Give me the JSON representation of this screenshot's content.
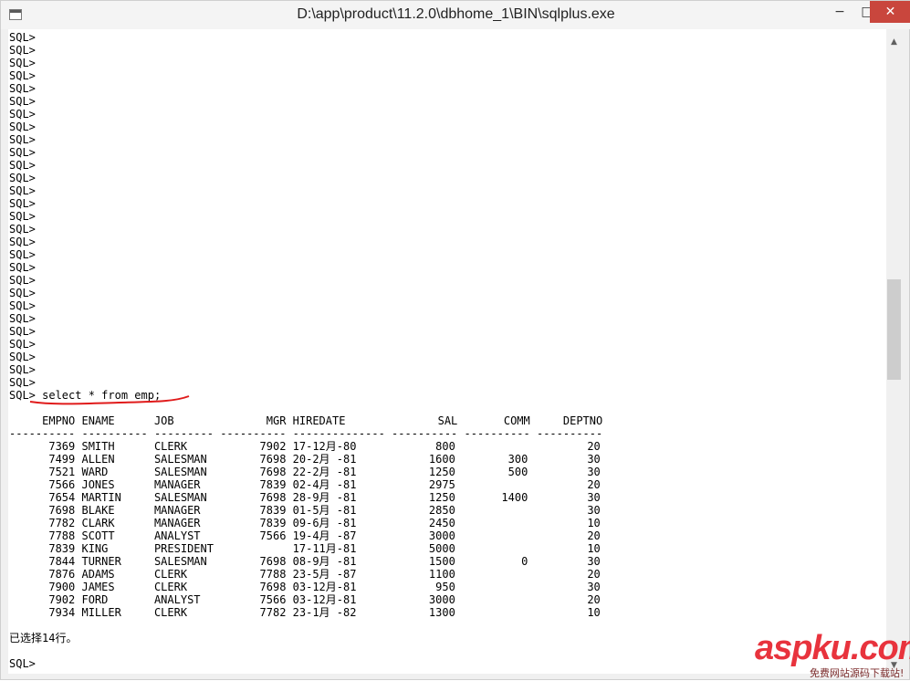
{
  "window": {
    "title": "D:\\app\\product\\11.2.0\\dbhome_1\\BIN\\sqlplus.exe",
    "minimize_glyph": "−",
    "maximize_glyph": "□",
    "close_glyph": "✕",
    "icon": "console-app-icon"
  },
  "console": {
    "prompts": [
      "SQL>",
      "SQL>",
      "SQL>",
      "SQL>",
      "SQL>",
      "SQL>",
      "SQL>",
      "SQL>",
      "SQL>",
      "SQL>",
      "SQL>",
      "SQL>",
      "SQL>",
      "SQL>",
      "SQL>",
      "SQL>",
      "SQL>",
      "SQL>",
      "SQL>",
      "SQL>",
      "SQL>",
      "SQL>",
      "SQL>",
      "SQL>",
      "SQL>",
      "SQL>",
      "SQL>",
      "SQL>"
    ],
    "command": "SQL> select * from emp;",
    "header": "     EMPNO ENAME      JOB              MGR HIREDATE              SAL       COMM     DEPTNO",
    "separator": "---------- ---------- --------- ---------- -------------- ---------- ---------- ----------",
    "rows": [
      "      7369 SMITH      CLERK           7902 17-12月-80            800                    20",
      "      7499 ALLEN      SALESMAN        7698 20-2月 -81           1600        300         30",
      "      7521 WARD       SALESMAN        7698 22-2月 -81           1250        500         30",
      "      7566 JONES      MANAGER         7839 02-4月 -81           2975                    20",
      "      7654 MARTIN     SALESMAN        7698 28-9月 -81           1250       1400         30",
      "      7698 BLAKE      MANAGER         7839 01-5月 -81           2850                    30",
      "      7782 CLARK      MANAGER         7839 09-6月 -81           2450                    10",
      "      7788 SCOTT      ANALYST         7566 19-4月 -87           3000                    20",
      "      7839 KING       PRESIDENT            17-11月-81           5000                    10",
      "      7844 TURNER     SALESMAN        7698 08-9月 -81           1500          0         30",
      "      7876 ADAMS      CLERK           7788 23-5月 -87           1100                    20",
      "      7900 JAMES      CLERK           7698 03-12月-81            950                    30",
      "      7902 FORD       ANALYST         7566 03-12月-81           3000                    20",
      "      7934 MILLER     CLERK           7782 23-1月 -82           1300                    10"
    ],
    "row_count_msg": "已选择14行。",
    "final_prompt": "SQL>"
  },
  "scrollbar": {
    "up_glyph": "▲",
    "down_glyph": "▼"
  },
  "watermark": {
    "main": "aspku.com",
    "sub": "免费网站源码下载站!"
  },
  "colors": {
    "annotation": "#e01b1b",
    "watermark": "#e8333d",
    "close_button": "#c9463d"
  }
}
